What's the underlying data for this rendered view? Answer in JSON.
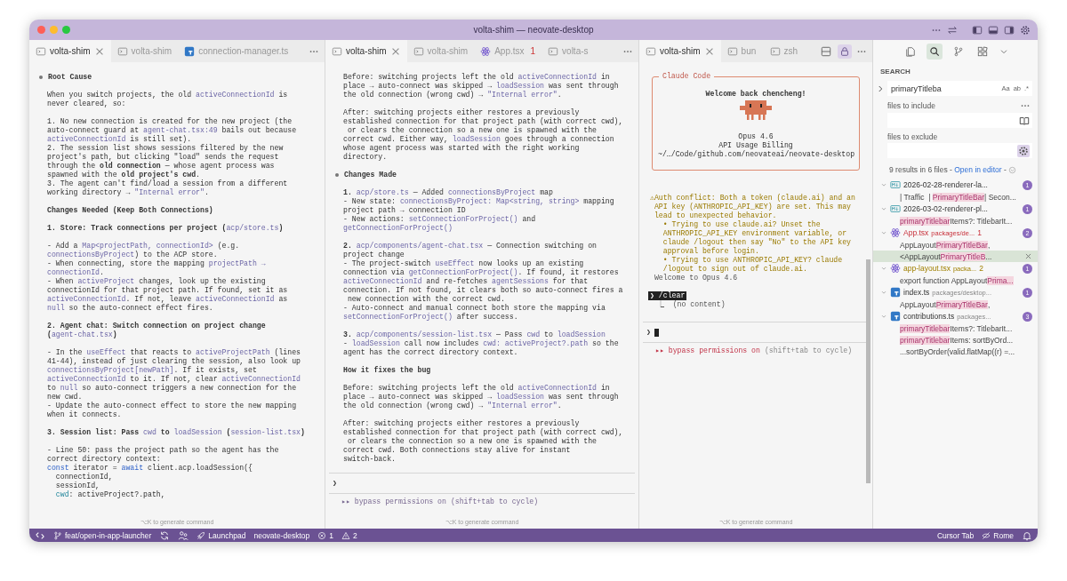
{
  "window": {
    "title": "volta-shim — neovate-desktop"
  },
  "panes": [
    {
      "tabs": [
        {
          "label": "volta-shim",
          "kind": "terminal",
          "selected": true
        },
        {
          "label": "volta-shim",
          "kind": "terminal",
          "selected": false
        },
        {
          "label": "connection-manager.ts",
          "kind": "ts",
          "selected": false
        }
      ],
      "blocks": [
        {
          "kind": "heading",
          "text": "Root Cause"
        },
        {
          "kind": "para",
          "lines": [
            [
              "When you switch projects, the old ",
              {
                "kind": "code",
                "text": "activeConnectionId"
              },
              " is"
            ],
            "never cleared, so:"
          ]
        },
        {
          "kind": "para",
          "lines": [
            "1. No new connection is created for the new project (the",
            [
              "auto-connect guard at ",
              {
                "kind": "code",
                "text": "agent-chat.tsx:49"
              },
              " bails out because"
            ],
            [
              {
                "kind": "code",
                "text": "activeConnectionId"
              },
              " is still set)."
            ],
            "2. The session list shows sessions filtered by the new",
            "project's path, but clicking \"load\" sends the request",
            "through the **old connection** — whose agent process was",
            "spawned with the **old project's cwd**.",
            "3. The agent can't find/load a session from a different",
            [
              "working directory → ",
              {
                "kind": "code",
                "text": "\"Internal error\""
              },
              "."
            ]
          ]
        },
        {
          "kind": "para",
          "lines": [
            "**Changes Needed (Keep Both Connections)**"
          ]
        },
        {
          "kind": "para",
          "lines": [
            [
              "**1. Store: Track connections per project (**",
              {
                "kind": "code",
                "text": "acp/store.ts"
              },
              "**)**"
            ]
          ]
        },
        {
          "kind": "para",
          "lines": [
            [
              "- Add a ",
              {
                "kind": "code",
                "text": "Map<projectPath, connectionId>"
              },
              " (e.g."
            ],
            [
              {
                "kind": "code",
                "text": "connectionsByProject"
              },
              ") to the ACP store."
            ],
            [
              "- When connecting, store the mapping ",
              {
                "kind": "code",
                "text": "projectPath →"
              }
            ],
            [
              {
                "kind": "code",
                "text": "connectionId"
              },
              "."
            ],
            [
              "- When ",
              {
                "kind": "code",
                "text": "activeProject"
              },
              " changes, look up the existing"
            ],
            "connectionId for that project path. If found, set it as",
            [
              {
                "kind": "code",
                "text": "activeConnectionId"
              },
              ". If not, leave ",
              {
                "kind": "code",
                "text": "activeConnectionId"
              },
              " as"
            ],
            [
              {
                "kind": "code",
                "text": "null"
              },
              " so the auto-connect effect fires."
            ]
          ]
        },
        {
          "kind": "para",
          "lines": [
            "**2. Agent chat: Switch connection on project change**",
            [
              "**(**",
              {
                "kind": "code",
                "text": "agent-chat.tsx"
              },
              "**)**"
            ]
          ]
        },
        {
          "kind": "para",
          "lines": [
            [
              "- In the ",
              {
                "kind": "code",
                "text": "useEffect"
              },
              " that reacts to ",
              {
                "kind": "code",
                "text": "activeProjectPath"
              },
              " (lines"
            ],
            "41-44), instead of just clearing the session, also look up",
            [
              {
                "kind": "code",
                "text": "connectionsByProject[newPath]"
              },
              ". If it exists, set"
            ],
            [
              {
                "kind": "code",
                "text": "activeConnectionId"
              },
              " to it. If not, clear ",
              {
                "kind": "code",
                "text": "activeConnectionId"
              }
            ],
            [
              "to ",
              {
                "kind": "code",
                "text": "null"
              },
              " so auto-connect triggers a new connection for the"
            ],
            "new cwd.",
            "- Update the auto-connect effect to store the new mapping",
            "when it connects."
          ]
        },
        {
          "kind": "para",
          "lines": [
            [
              "**3. Session list: Pass** ",
              {
                "kind": "code",
                "text": "cwd"
              },
              " **to** ",
              {
                "kind": "code",
                "text": "loadSession"
              },
              " **(**",
              {
                "kind": "code",
                "text": "session-list.tsx"
              },
              "**)**"
            ]
          ]
        },
        {
          "kind": "para",
          "lines": [
            "- Line 50: pass the project path so the agent has the",
            "correct directory context:",
            [
              {
                "kind": "keyword",
                "text": "const"
              },
              " iterator = ",
              {
                "kind": "keyword",
                "text": "await"
              },
              " client.acp.loadSession({"
            ],
            "  connectionId,",
            "  sessionId,",
            [
              {
                "kind": "prop",
                "text": "  cwd"
              },
              ": activeProject?.path,"
            ]
          ]
        }
      ],
      "footer": "⌥K to generate command"
    },
    {
      "tabs": [
        {
          "label": "volta-shim",
          "kind": "terminal",
          "selected": true
        },
        {
          "label": "volta-shim",
          "kind": "terminal",
          "selected": false
        },
        {
          "label": "App.tsx",
          "kind": "react",
          "problems": "1",
          "selected": false
        },
        {
          "label": "volta-s",
          "kind": "terminal",
          "selected": false
        }
      ],
      "blocks": [
        {
          "kind": "para",
          "lines": [
            [
              "Before: switching projects left the old ",
              {
                "kind": "code",
                "text": "activeConnectionId"
              },
              " in"
            ],
            [
              "place → auto-connect was skipped → ",
              {
                "kind": "code",
                "text": "loadSession"
              },
              " was sent through"
            ],
            [
              "the old connection (wrong cwd) → ",
              {
                "kind": "code",
                "text": "\"Internal error\""
              },
              "."
            ]
          ]
        },
        {
          "kind": "para",
          "lines": [
            "After: switching projects either restores a previously",
            "established connection for that project path (with correct cwd),",
            " or clears the connection so a new one is spawned with the",
            [
              "correct cwd. Either way, ",
              {
                "kind": "code",
                "text": "loadSession"
              },
              " goes through a connection"
            ],
            "whose agent process was started with the right working",
            "directory."
          ]
        },
        {
          "kind": "heading",
          "text": "Changes Made"
        },
        {
          "kind": "para",
          "lines": [
            [
              "**1.** ",
              {
                "kind": "code",
                "text": "acp/store.ts"
              },
              " — Added ",
              {
                "kind": "code",
                "text": "connectionsByProject"
              },
              " map"
            ],
            [
              "- New state: ",
              {
                "kind": "code",
                "text": "connectionsByProject: Map<string, string>"
              },
              " mapping"
            ],
            "project path → connection ID",
            [
              "- New actions: ",
              {
                "kind": "code",
                "text": "setConnectionForProject()"
              },
              " and"
            ],
            [
              {
                "kind": "code",
                "text": "getConnectionForProject()"
              }
            ]
          ]
        },
        {
          "kind": "para",
          "lines": [
            [
              "**2.** ",
              {
                "kind": "code",
                "text": "acp/components/agent-chat.tsx"
              },
              " — Connection switching on"
            ],
            "project change",
            [
              "- The project-switch ",
              {
                "kind": "code",
                "text": "useEffect"
              },
              " now looks up an existing"
            ],
            [
              "connection via ",
              {
                "kind": "code",
                "text": "getConnectionForProject()"
              },
              ". If found, it restores"
            ],
            [
              {
                "kind": "code",
                "text": "activeConnectionId"
              },
              " and re-fetches ",
              {
                "kind": "code",
                "text": "agentSessions"
              },
              " for that"
            ],
            "connection. If not found, it clears both so auto-connect fires a",
            " new connection with the correct cwd.",
            "- Auto-connect and manual connect both store the mapping via",
            [
              {
                "kind": "code",
                "text": "setConnectionForProject()"
              },
              " after success."
            ]
          ]
        },
        {
          "kind": "para",
          "lines": [
            [
              "**3.** ",
              {
                "kind": "code",
                "text": "acp/components/session-list.tsx"
              },
              " — Pass ",
              {
                "kind": "code",
                "text": "cwd"
              },
              " to ",
              {
                "kind": "code",
                "text": "loadSession"
              }
            ],
            [
              "- ",
              {
                "kind": "code",
                "text": "loadSession"
              },
              " call now includes ",
              {
                "kind": "code",
                "text": "cwd: activeProject?.path"
              },
              " so the"
            ],
            "agent has the correct directory context."
          ]
        },
        {
          "kind": "para",
          "lines": [
            "**How it fixes the bug**"
          ]
        },
        {
          "kind": "para",
          "lines": [
            [
              "Before: switching projects left the old ",
              {
                "kind": "code",
                "text": "activeConnectionId"
              },
              " in"
            ],
            [
              "place → auto-connect was skipped → ",
              {
                "kind": "code",
                "text": "loadSession"
              },
              " was sent through"
            ],
            [
              "the old connection (wrong cwd) → ",
              {
                "kind": "code",
                "text": "\"Internal error\""
              },
              "."
            ]
          ]
        },
        {
          "kind": "para",
          "lines": [
            "After: switching projects either restores a previously",
            "established connection for that project path (with correct cwd),",
            " or clears the connection so a new one is spawned with the",
            "correct cwd. Both connections stay alive for instant",
            "switch-back."
          ]
        }
      ],
      "prompt": {
        "symbol": "❯",
        "focused": false,
        "mode": "▸▸ bypass permissions on",
        "hint": "(shift+tab to cycle)"
      },
      "footer": "⌥K to generate command"
    }
  ],
  "claude_pane": {
    "tabs": [
      {
        "label": "volta-shim",
        "kind": "terminal",
        "selected": true
      },
      {
        "label": "bun",
        "kind": "terminal",
        "selected": false
      },
      {
        "label": "zsh",
        "kind": "terminal",
        "selected": false
      }
    ],
    "lock_on": true,
    "welcome": {
      "title": "Claude Code",
      "greeting": "Welcome back chencheng!",
      "model": "Opus 4.6",
      "billing": "API Usage Billing",
      "path": "~/…/Code/github.com/neovateai/neovate-desktop"
    },
    "log": [
      {
        "kind": "warning",
        "text": "⚠Auth conflict: Both a token (claude.ai) and an"
      },
      {
        "kind": "warning",
        "text": " API key (ANTHROPIC_API_KEY) are set. This may"
      },
      {
        "kind": "warning",
        "text": " lead to unexpected behavior."
      },
      {
        "kind": "warning",
        "text": "   • Trying to use claude.ai? Unset the"
      },
      {
        "kind": "warning",
        "text": "   ANTHROPIC_API_KEY environment variable, or"
      },
      {
        "kind": "warning",
        "text": "   claude /logout then say \"No\" to the API key"
      },
      {
        "kind": "warning",
        "text": "   approval before login."
      },
      {
        "kind": "warning",
        "text": "   • Trying to use ANTHROPIC_API_KEY? claude"
      },
      {
        "kind": "warning",
        "text": "   /logout to sign out of claude.ai."
      },
      {
        "kind": "dim",
        "text": " Welcome to Opus 4.6"
      }
    ],
    "command": {
      "text": "❯ /clear",
      "result": "  ⎿  (no content)"
    },
    "prompt": {
      "symbol": "❯",
      "focused": true,
      "mode": "▸▸ bypass permissions on",
      "hint": "(shift+tab to cycle)"
    },
    "footer": "⌥K to generate command"
  },
  "search": {
    "activity": [
      {
        "kind": "files",
        "selected": false
      },
      {
        "kind": "search",
        "selected": true
      },
      {
        "kind": "branch",
        "selected": false
      },
      {
        "kind": "extensions",
        "selected": false
      }
    ],
    "title": "SEARCH",
    "query": "primaryTitleba",
    "toggles": [
      "Aa",
      "ab",
      ".*"
    ],
    "include_label": "files to include",
    "exclude_label": "files to exclude",
    "exclude_filter_on": true,
    "summary": "9 results in 6 files - ",
    "open_link": "Open in editor",
    "summary_tail": " - ",
    "files": [
      {
        "name": "2026-02-28-renderer-la...",
        "kind": "markdown",
        "errors": false,
        "warnings": false,
        "count": "1",
        "expanded": true,
        "matches": [
          {
            "selected": false,
            "segments": [
              "| Traffic  | ",
              {
                "kind": "match",
                "text": "PrimaryTitleBar"
              },
              "| Secon..."
            ]
          }
        ]
      },
      {
        "name": "2026-03-02-renderer-pl...",
        "kind": "markdown",
        "errors": false,
        "warnings": false,
        "count": "1",
        "expanded": true,
        "matches": [
          {
            "selected": false,
            "segments": [
              {
                "kind": "match",
                "text": "primaryTitlebar"
              },
              "Items?: TitlebarIt..."
            ]
          }
        ]
      },
      {
        "name": "App.tsx",
        "kind": "react",
        "path": "packages/de...",
        "problems": "1",
        "errors": true,
        "warnings": false,
        "count": "2",
        "expanded": true,
        "matches": [
          {
            "selected": false,
            "segments": [
              "AppLayout",
              {
                "kind": "match",
                "text": "PrimaryTitleBar"
              },
              ","
            ]
          },
          {
            "selected": true,
            "segments": [
              "<AppLayout",
              {
                "kind": "match",
                "text": "PrimaryTitleB"
              },
              "..."
            ]
          }
        ]
      },
      {
        "name": "app-layout.tsx",
        "kind": "react",
        "path": "packa...",
        "problems": "2",
        "errors": false,
        "warnings": true,
        "count": "1",
        "expanded": true,
        "matches": [
          {
            "selected": false,
            "segments": [
              "export function AppLayout",
              {
                "kind": "match",
                "text": "Prima..."
              }
            ]
          }
        ]
      },
      {
        "name": "index.ts",
        "kind": "ts",
        "path": "packages/desktop...",
        "errors": false,
        "warnings": false,
        "count": "1",
        "expanded": true,
        "matches": [
          {
            "selected": false,
            "segments": [
              "AppLayout",
              {
                "kind": "match",
                "text": "PrimaryTitleBar"
              },
              ","
            ]
          }
        ]
      },
      {
        "name": "contributions.ts",
        "kind": "ts",
        "path": "packages...",
        "errors": false,
        "warnings": false,
        "count": "3",
        "expanded": true,
        "matches": [
          {
            "selected": false,
            "segments": [
              {
                "kind": "match",
                "text": "primaryTitlebar"
              },
              "Items?: TitlebarIt..."
            ]
          },
          {
            "selected": false,
            "segments": [
              {
                "kind": "match",
                "text": "primaryTitlebar"
              },
              "Items: sortByOrd..."
            ]
          },
          {
            "selected": false,
            "segments": [
              "...sortByOrder(valid.flatMap((r) =..."
            ]
          }
        ]
      }
    ]
  },
  "status_bar": {
    "left": [
      {
        "kind": "remote"
      },
      {
        "kind": "branch",
        "text": "feat/open-in-app-launcher"
      },
      {
        "kind": "sync"
      },
      {
        "kind": "accounts"
      },
      {
        "kind": "rocket",
        "text": "Launchpad"
      },
      {
        "kind": "plain",
        "text": "neovate-desktop"
      },
      {
        "kind": "error",
        "text": "1"
      },
      {
        "kind": "warning",
        "text": "2"
      }
    ],
    "right": [
      {
        "kind": "plain",
        "text": "Cursor Tab"
      },
      {
        "kind": "slashed",
        "text": "Rome"
      },
      {
        "kind": "bell"
      }
    ]
  }
}
